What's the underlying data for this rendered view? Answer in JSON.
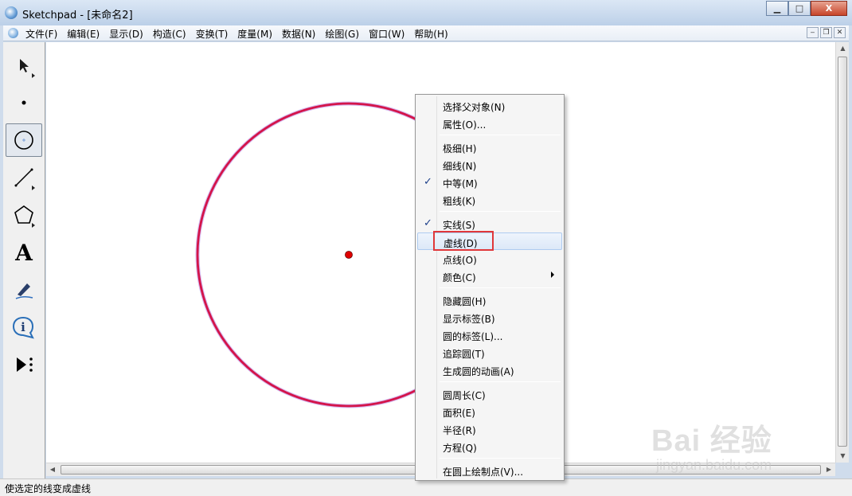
{
  "window": {
    "title": "Sketchpad - [未命名2]",
    "minimize_label": "▁",
    "maximize_label": "□",
    "close_label": "X"
  },
  "menubar": {
    "items": [
      "文件(F)",
      "编辑(E)",
      "显示(D)",
      "构造(C)",
      "变换(T)",
      "度量(M)",
      "数据(N)",
      "绘图(G)",
      "窗口(W)",
      "帮助(H)"
    ]
  },
  "toolbox": {
    "tools": [
      {
        "name": "arrow-tool",
        "active": false
      },
      {
        "name": "point-tool",
        "active": false
      },
      {
        "name": "compass-tool",
        "active": true
      },
      {
        "name": "straightedge-tool",
        "active": false
      },
      {
        "name": "polygon-tool",
        "active": false
      },
      {
        "name": "text-tool",
        "active": false,
        "glyph": "A"
      },
      {
        "name": "marker-tool",
        "active": false
      },
      {
        "name": "information-tool",
        "active": false,
        "glyph": "i"
      },
      {
        "name": "custom-tool",
        "active": false
      }
    ]
  },
  "canvas": {
    "circle_color": "#d4144a",
    "center_color": "#e00000"
  },
  "context_menu": {
    "items": [
      {
        "label": "选择父对象(N)",
        "checked": false,
        "hover": false
      },
      {
        "label": "属性(O)...",
        "checked": false,
        "hover": false
      },
      {
        "separator": true
      },
      {
        "label": "极细(H)",
        "checked": false,
        "hover": false
      },
      {
        "label": "细线(N)",
        "checked": false,
        "hover": false
      },
      {
        "label": "中等(M)",
        "checked": true,
        "hover": false
      },
      {
        "label": "粗线(K)",
        "checked": false,
        "hover": false
      },
      {
        "separator": true
      },
      {
        "label": "实线(S)",
        "checked": true,
        "hover": false
      },
      {
        "label": "虚线(D)",
        "checked": false,
        "hover": true
      },
      {
        "label": "点线(O)",
        "checked": false,
        "hover": false
      },
      {
        "label": "颜色(C)",
        "checked": false,
        "hover": false,
        "submenu": true
      },
      {
        "separator": true
      },
      {
        "label": "隐藏圆(H)",
        "checked": false,
        "hover": false
      },
      {
        "label": "显示标签(B)",
        "checked": false,
        "hover": false
      },
      {
        "label": "圆的标签(L)...",
        "checked": false,
        "hover": false
      },
      {
        "label": "追踪圆(T)",
        "checked": false,
        "hover": false
      },
      {
        "label": "生成圆的动画(A)",
        "checked": false,
        "hover": false
      },
      {
        "separator": true
      },
      {
        "label": "圆周长(C)",
        "checked": false,
        "hover": false
      },
      {
        "label": "面积(E)",
        "checked": false,
        "hover": false
      },
      {
        "label": "半径(R)",
        "checked": false,
        "hover": false
      },
      {
        "label": "方程(Q)",
        "checked": false,
        "hover": false
      },
      {
        "separator": true
      },
      {
        "label": "在圆上绘制点(V)...",
        "checked": false,
        "hover": false
      }
    ],
    "check_glyph": "✓",
    "highlight_color": "#e0373a"
  },
  "statusbar": {
    "text": "使选定的线变成虚线"
  },
  "watermark": {
    "main": "Bai 经验",
    "sub": "jingyan.baidu.com"
  }
}
